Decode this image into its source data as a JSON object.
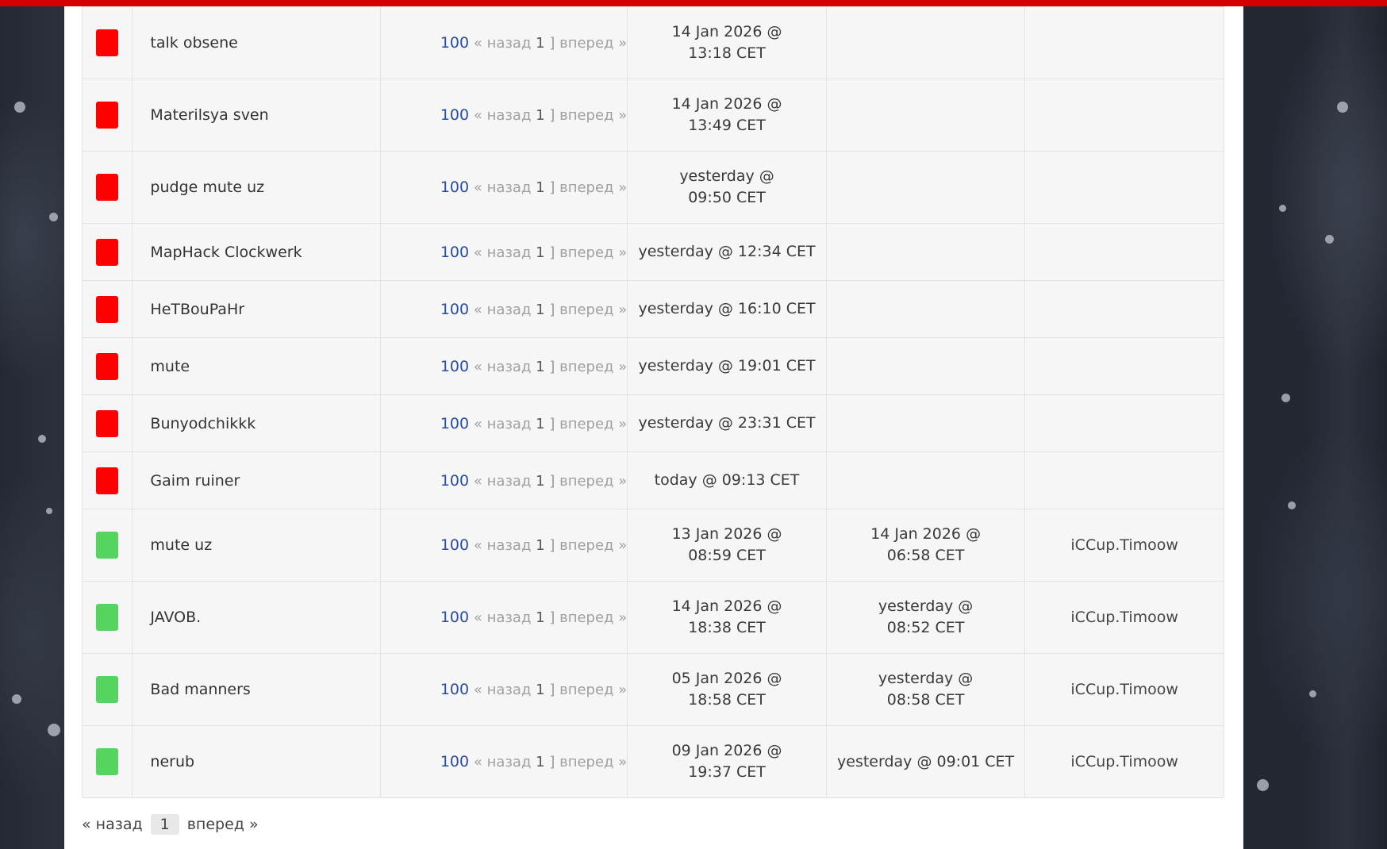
{
  "colors": {
    "open": "#ff0000",
    "closed": "#55d460",
    "accent": "#d40000",
    "link": "#2b4c9e"
  },
  "pagination_inline": {
    "prev": "« назад",
    "next": "вперед »",
    "bracket": "]"
  },
  "rows": [
    {
      "status": "red",
      "title": "talk obsene",
      "count": "100",
      "page": "1",
      "created": "14 Jan 2026 @ 13:18 CET",
      "closed": "",
      "moderator": ""
    },
    {
      "status": "red",
      "title": "Materilsya sven",
      "count": "100",
      "page": "1",
      "created": "14 Jan 2026 @ 13:49 CET",
      "closed": "",
      "moderator": ""
    },
    {
      "status": "red",
      "title": "pudge mute uz",
      "count": "100",
      "page": "1",
      "created": "yesterday @ 09:50 CET",
      "closed": "",
      "moderator": ""
    },
    {
      "status": "red",
      "title": "MapHack Clockwerk",
      "count": "100",
      "page": "1",
      "created": "yesterday @ 12:34 CET",
      "closed": "",
      "moderator": ""
    },
    {
      "status": "red",
      "title": "HeTBouPaHr",
      "count": "100",
      "page": "1",
      "created": "yesterday @ 16:10 CET",
      "closed": "",
      "moderator": ""
    },
    {
      "status": "red",
      "title": "mute",
      "count": "100",
      "page": "1",
      "created": "yesterday @ 19:01 CET",
      "closed": "",
      "moderator": ""
    },
    {
      "status": "red",
      "title": "Bunyodchikkk",
      "count": "100",
      "page": "1",
      "created": "yesterday @ 23:31 CET",
      "closed": "",
      "moderator": ""
    },
    {
      "status": "red",
      "title": "Gaim ruiner",
      "count": "100",
      "page": "1",
      "created": "today @ 09:13 CET",
      "closed": "",
      "moderator": ""
    },
    {
      "status": "green",
      "title": "mute uz",
      "count": "100",
      "page": "1",
      "created": "13 Jan 2026 @ 08:59 CET",
      "closed": "14 Jan 2026 @ 06:58 CET",
      "moderator": "iCCup.Timoow"
    },
    {
      "status": "green",
      "title": "JAVOB.",
      "count": "100",
      "page": "1",
      "created": "14 Jan 2026 @ 18:38 CET",
      "closed": "yesterday @ 08:52 CET",
      "moderator": "iCCup.Timoow"
    },
    {
      "status": "green",
      "title": "Bad manners",
      "count": "100",
      "page": "1",
      "created": "05 Jan 2026 @ 18:58 CET",
      "closed": "yesterday @ 08:58 CET",
      "moderator": "iCCup.Timoow"
    },
    {
      "status": "green",
      "title": "nerub",
      "count": "100",
      "page": "1",
      "created": "09 Jan 2026 @ 19:37 CET",
      "closed": "yesterday @ 09:01 CET",
      "moderator": "iCCup.Timoow"
    }
  ],
  "pager": {
    "prev": "« назад",
    "current": "1",
    "next": "вперед »"
  }
}
